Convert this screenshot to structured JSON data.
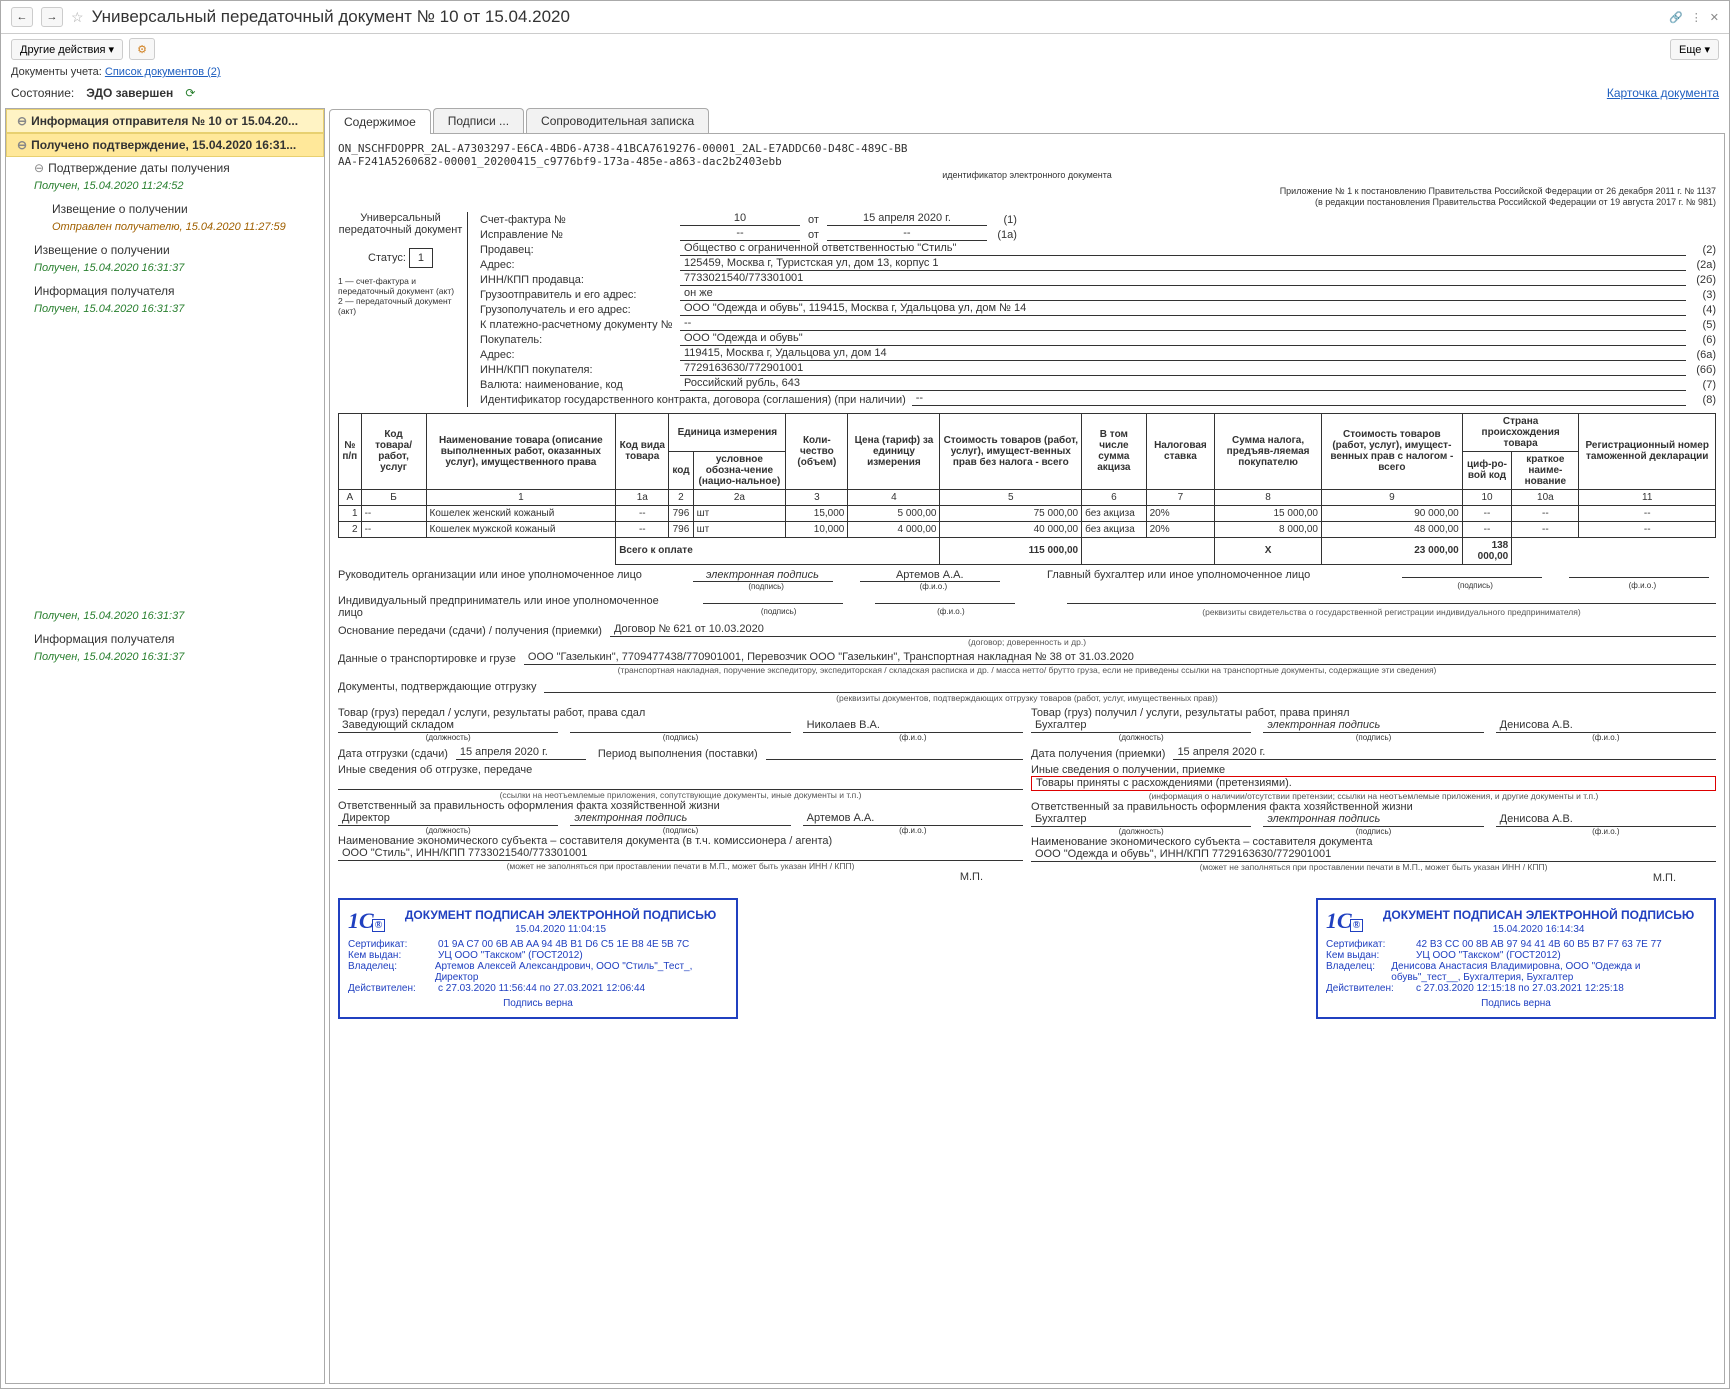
{
  "title": "Универсальный передаточный документ № 10 от 15.04.2020",
  "toolbar": {
    "other_actions": "Другие действия",
    "more": "Еще"
  },
  "links": {
    "docs_label": "Документы учета:",
    "docs_link": "Список документов (2)",
    "card": "Карточка документа"
  },
  "status": {
    "label": "Состояние:",
    "value": "ЭДО завершен"
  },
  "sidebar": {
    "items": [
      {
        "label": "Информация отправителя № 10 от 15.04.20...",
        "hl": true
      },
      {
        "label": "Получено подтверждение, 15.04.2020 16:31...",
        "hl2": true
      },
      {
        "label": "Подтверждение даты получения",
        "status": "Получен, 15.04.2020 11:24:52",
        "indent": 1
      },
      {
        "label": "Извещение о получении",
        "status": "Отправлен получателю, 15.04.2020 11:27:59",
        "indent": 2
      },
      {
        "label": "Извещение о получении",
        "status": "Получен, 15.04.2020 16:31:37",
        "indent": 1
      },
      {
        "label": "Информация получателя",
        "status": "Получен, 15.04.2020 16:31:37",
        "indent": 1
      },
      {
        "label": "",
        "status": "Получен, 15.04.2020 16:31:37",
        "indent": 1,
        "spacer": true
      },
      {
        "label": "Информация получателя",
        "status": "Получен, 15.04.2020 16:31:37",
        "indent": 1
      }
    ]
  },
  "tabs": [
    "Содержимое",
    "Подписи ...",
    "Сопроводительная записка"
  ],
  "doc": {
    "id_line1": "ON_NSCHFDOPPR_2AL-A7303297-E6CA-4BD6-A738-41BCA7619276-00001_2AL-E7ADDC60-D48C-489C-BB",
    "id_line2": "AA-F241A5260682-00001_20200415_c9776bf9-173a-485e-a863-dac2b2403ebb",
    "id_label": "идентификатор электронного документа",
    "upd_label": "Универсальный передаточный документ",
    "status_label": "Статус:",
    "status_val": "1",
    "legend": "1 — счет-фактура и передаточный документ (акт)\n2 — передаточный документ (акт)",
    "right_note": "Приложение № 1 к постановлению Правительства Российской Федерации от 26 декабря 2011 г. № 1137\n(в редакции постановления Правительства Российской Федерации от 19 августа 2017 г. № 981)",
    "invoice": {
      "num_label": "Счет-фактура №",
      "num": "10",
      "from": "от",
      "date": "15 апреля 2020 г.",
      "n1": "(1)",
      "fix_label": "Исправление №",
      "fix_num": "--",
      "fix_date": "--",
      "n1a": "(1а)"
    },
    "fields": [
      {
        "lbl": "Продавец:",
        "val": "Общество с ограниченной ответственностью \"Стиль\"",
        "n": "(2)"
      },
      {
        "lbl": "Адрес:",
        "val": "125459, Москва г, Туристская ул, дом 13, корпус 1",
        "n": "(2а)"
      },
      {
        "lbl": "ИНН/КПП продавца:",
        "val": "7733021540/773301001",
        "n": "(2б)"
      },
      {
        "lbl": "Грузоотправитель и его адрес:",
        "val": "он же",
        "n": "(3)"
      },
      {
        "lbl": "Грузополучатель и его адрес:",
        "val": "ООО \"Одежда и обувь\", 119415, Москва г, Удальцова ул, дом № 14",
        "n": "(4)"
      },
      {
        "lbl": "К платежно-расчетному документу №",
        "val": "--",
        "n": "(5)"
      },
      {
        "lbl": "Покупатель:",
        "val": "ООО \"Одежда и обувь\"",
        "n": "(6)"
      },
      {
        "lbl": "Адрес:",
        "val": "119415, Москва г, Удальцова ул, дом 14",
        "n": "(6а)"
      },
      {
        "lbl": "ИНН/КПП покупателя:",
        "val": "7729163630/772901001",
        "n": "(6б)"
      },
      {
        "lbl": "Валюта: наименование, код",
        "val": "Российский рубль, 643",
        "n": "(7)"
      },
      {
        "lbl": "Идентификатор государственного контракта, договора (соглашения) (при наличии)",
        "val": "--",
        "n": "(8)"
      }
    ],
    "table": {
      "headers": {
        "h_num": "№ п/п",
        "h_code": "Код товара/ работ, услуг",
        "h_name": "Наименование товара (описание выполненных работ, оказанных услуг), имущественного права",
        "h_typecode": "Код вида товара",
        "h_unit": "Единица измерения",
        "h_unit_code": "код",
        "h_unit_name": "условное обозна-чение (нацио-нальное)",
        "h_qty": "Коли-чество (объем)",
        "h_price": "Цена (тариф) за единицу измерения",
        "h_cost": "Стоимость товаров (работ, услуг), имущест-венных прав без налога - всего",
        "h_excise": "В том числе сумма акциза",
        "h_rate": "Налоговая ставка",
        "h_tax": "Сумма налога, предъяв-ляемая покупателю",
        "h_total": "Стоимость товаров (работ, услуг), имущест-венных прав с налогом - всего",
        "h_country": "Страна происхождения товара",
        "h_cc": "циф-ро-вой код",
        "h_cn": "краткое наиме-нование",
        "h_decl": "Регистрационный номер таможенной декларации",
        "colnums": [
          "А",
          "Б",
          "1",
          "1а",
          "2",
          "2а",
          "3",
          "4",
          "5",
          "6",
          "7",
          "8",
          "9",
          "10",
          "10а",
          "11"
        ]
      },
      "rows": [
        {
          "n": "1",
          "code": "--",
          "name": "Кошелек женский кожаный",
          "tc": "--",
          "uc": "796",
          "un": "шт",
          "qty": "15,000",
          "price": "5 000,00",
          "cost": "75 000,00",
          "exc": "без акциза",
          "rate": "20%",
          "tax": "15 000,00",
          "total": "90 000,00",
          "cc": "--",
          "cn": "--",
          "decl": "--"
        },
        {
          "n": "2",
          "code": "--",
          "name": "Кошелек мужской кожаный",
          "tc": "--",
          "uc": "796",
          "un": "шт",
          "qty": "10,000",
          "price": "4 000,00",
          "cost": "40 000,00",
          "exc": "без акциза",
          "rate": "20%",
          "tax": "8 000,00",
          "total": "48 000,00",
          "cc": "--",
          "cn": "--",
          "decl": "--"
        }
      ],
      "total_label": "Всего к оплате",
      "total_cost": "115 000,00",
      "total_x": "X",
      "total_tax": "23 000,00",
      "total_total": "138 000,00"
    },
    "sig": {
      "head_lbl": "Руководитель организации или иное уполномоченное лицо",
      "e_sign": "электронная подпись",
      "head_name": "Артемов А.А.",
      "acc_lbl": "Главный бухгалтер или иное уполномоченное лицо",
      "ip_lbl": "Индивидуальный предприниматель или иное уполномоченное лицо",
      "ip_note": "(реквизиты свидетельства о государственной регистрации индивидуального предпринимателя)",
      "sub_sign": "(подпись)",
      "sub_name": "(ф.и.о.)"
    },
    "basis": {
      "lbl": "Основание передачи (сдачи) / получения (приемки)",
      "val": "Договор № 621 от 10.03.2020",
      "note": "(договор; доверенность и др.)"
    },
    "transport": {
      "lbl": "Данные о транспортировке и грузе",
      "val": "ООО \"Газелькин\", 7709477438/770901001, Перевозчик ООО \"Газелькин\", Транспортная накладная № 38 от 31.03.2020",
      "note": "(транспортная накладная, поручение экспедитору, экспедиторская / складская расписка и др. / масса нетто/ брутто груза, если не приведены ссылки на транспортные документы, содержащие эти сведения)"
    },
    "confirm": {
      "lbl": "Документы, подтверждающие отгрузку",
      "val": "",
      "note": "(реквизиты документов, подтверждающих отгрузку товаров (работ, услуг, имущественных прав))"
    },
    "left": {
      "title": "Товар (груз) передал / услуги, результаты работ, права сдал",
      "pos": "Заведующий складом",
      "name": "Николаев В.А.",
      "date_lbl": "Дата отгрузки (сдачи)",
      "date": "15 апреля 2020 г.",
      "period_lbl": "Период выполнения (поставки)",
      "other_lbl": "Иные сведения об отгрузке, передаче",
      "other": "",
      "other_note": "(ссылки на неотъемлемые приложения, сопутствующие документы, иные документы и т.п.)",
      "resp_lbl": "Ответственный за правильность оформления факта хозяйственной жизни",
      "resp_pos": "Директор",
      "resp_name": "Артемов А.А.",
      "subj_lbl": "Наименование экономического субъекта – составителя документа (в т.ч. комиссионера / агента)",
      "subj": "ООО \"Стиль\", ИНН/КПП 7733021540/773301001",
      "subj_note": "(может не заполняться при проставлении печати в М.П., может быть указан ИНН / КПП)",
      "mp": "М.П."
    },
    "right": {
      "title": "Товар (груз) получил / услуги, результаты работ, права принял",
      "pos": "Бухгалтер",
      "name": "Денисова А.В.",
      "date_lbl": "Дата получения (приемки)",
      "date": "15 апреля 2020 г.",
      "other_lbl": "Иные сведения о получении, приемке",
      "other": "Товары приняты с расхождениями (претензиями).",
      "other_note": "(информация о наличии/отсутствии претензии; ссылки на неотъемлемые приложения, и другие документы и т.п.)",
      "resp_lbl": "Ответственный за правильность оформления факта хозяйственной жизни",
      "resp_pos": "Бухгалтер",
      "resp_name": "Денисова А.В.",
      "subj_lbl": "Наименование экономического субъекта – составителя документа",
      "subj": "ООО \"Одежда и обувь\", ИНН/КПП 7729163630/772901001",
      "subj_note": "(может не заполняться при проставлении печати в М.П., может быть указан ИНН / КПП)",
      "mp": "М.П."
    },
    "pos_note": "(должность)",
    "stamps": [
      {
        "title": "ДОКУМЕНТ ПОДПИСАН ЭЛЕКТРОННОЙ ПОДПИСЬЮ",
        "date": "15.04.2020 11:04:15",
        "cert_k": "Сертификат:",
        "cert": "01 9A C7 00 6B AB AA 94 4B B1 D6 C5 1E B8 4E 5B 7C",
        "issuer_k": "Кем выдан:",
        "issuer": "УЦ ООО \"Такском\" (ГОСТ2012)",
        "owner_k": "Владелец:",
        "owner": "Артемов Алексей Александрович, ООО \"Стиль\"_Тест_, Директор",
        "valid_k": "Действителен:",
        "valid": "с 27.03.2020 11:56:44 по 27.03.2021 12:06:44",
        "foot": "Подпись верна"
      },
      {
        "title": "ДОКУМЕНТ ПОДПИСАН ЭЛЕКТРОННОЙ ПОДПИСЬЮ",
        "date": "15.04.2020 16:14:34",
        "cert_k": "Сертификат:",
        "cert": "42 B3 CC 00 8B AB 97 94 41 4B 60 B5 B7 F7 63 7E 77",
        "issuer_k": "Кем выдан:",
        "issuer": "УЦ ООО \"Такском\" (ГОСТ2012)",
        "owner_k": "Владелец:",
        "owner": "Денисова Анастасия Владимировна, ООО \"Одежда и обувь\"_тест__, Бухгалтерия, Бухгалтер",
        "valid_k": "Действителен:",
        "valid": "с 27.03.2020 12:15:18 по 27.03.2021 12:25:18",
        "foot": "Подпись верна"
      }
    ]
  }
}
